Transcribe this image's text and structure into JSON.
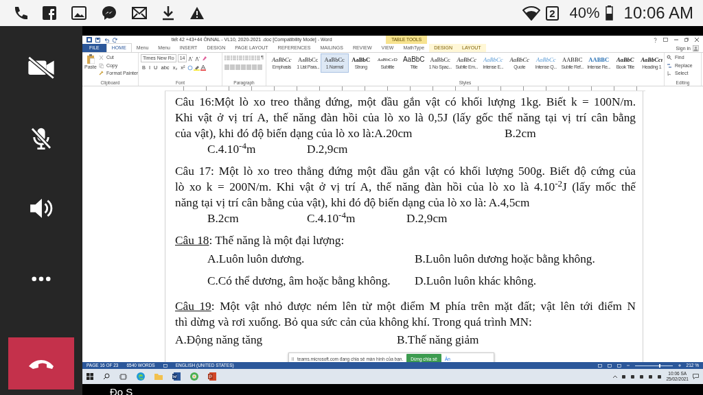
{
  "status_bar": {
    "sim": "2",
    "battery": "40%",
    "time": "10:06 AM"
  },
  "call_controls": {
    "camera_on": false,
    "mic_on": false
  },
  "participant": "Đo S",
  "word": {
    "title": "tiết 42 +43+44 ÔNNAL - VL10, 2020-2021 .doc [Compatibility Mode] - Word",
    "contextual_label": "TABLE TOOLS",
    "sign_in": "Sign in",
    "tabs": [
      {
        "label": "FILE",
        "kind": "file",
        "selected": false
      },
      {
        "label": "HOME",
        "kind": "normal",
        "selected": true
      },
      {
        "label": "Menu",
        "kind": "normal",
        "selected": false
      },
      {
        "label": "Menu",
        "kind": "normal",
        "selected": false
      },
      {
        "label": "INSERT",
        "kind": "normal",
        "selected": false
      },
      {
        "label": "DESIGN",
        "kind": "normal",
        "selected": false
      },
      {
        "label": "PAGE LAYOUT",
        "kind": "normal",
        "selected": false
      },
      {
        "label": "REFERENCES",
        "kind": "normal",
        "selected": false
      },
      {
        "label": "MAILINGS",
        "kind": "normal",
        "selected": false
      },
      {
        "label": "REVIEW",
        "kind": "normal",
        "selected": false
      },
      {
        "label": "VIEW",
        "kind": "normal",
        "selected": false
      },
      {
        "label": "MathType",
        "kind": "normal",
        "selected": false
      },
      {
        "label": "DESIGN",
        "kind": "contextual",
        "selected": false
      },
      {
        "label": "LAYOUT",
        "kind": "contextual",
        "selected": false
      }
    ],
    "clipboard": {
      "paste": "Paste",
      "cut": "Cut",
      "copy": "Copy",
      "format_painter": "Format Painter",
      "label": "Clipboard"
    },
    "font": {
      "name": "Times New Ro",
      "size": "14",
      "format_buttons": [
        "B",
        "I",
        "U",
        "abc",
        "x₂",
        "x²"
      ],
      "label": "Font"
    },
    "paragraph": {
      "marks": "¶",
      "label": "Paragraph"
    },
    "styles": {
      "label": "Styles",
      "items": [
        {
          "preview": "AaBbCc",
          "name": "Emphasis",
          "kind": "italic",
          "selected": false
        },
        {
          "preview": "AaBbCc",
          "name": "1 List Para...",
          "kind": "plain",
          "selected": false
        },
        {
          "preview": "AaBbCc",
          "name": "1 Normal",
          "kind": "plain",
          "selected": true
        },
        {
          "preview": "AaBbC",
          "name": "Strong",
          "kind": "bold",
          "selected": false
        },
        {
          "preview": "AaBbCcD",
          "name": "Subtitle",
          "kind": "small",
          "selected": false
        },
        {
          "preview": "AaBbC",
          "name": "Title",
          "kind": "title",
          "selected": false
        },
        {
          "preview": "AaBbCc",
          "name": "1 No Spac...",
          "kind": "plain",
          "selected": false
        },
        {
          "preview": "AaBbCc",
          "name": "Subtle Em...",
          "kind": "italic",
          "selected": false
        },
        {
          "preview": "AaBbCc",
          "name": "Intense E...",
          "kind": "accent",
          "selected": false
        },
        {
          "preview": "AaBbCc",
          "name": "Quote",
          "kind": "italic",
          "selected": false
        },
        {
          "preview": "AaBbCc",
          "name": "Intense Q...",
          "kind": "accent",
          "selected": false
        },
        {
          "preview": "AABBC",
          "name": "Subtle Ref...",
          "kind": "plain",
          "selected": false
        },
        {
          "preview": "AABBC",
          "name": "Intense Re...",
          "kind": "accentbold",
          "selected": false
        },
        {
          "preview": "AaBbC",
          "name": "Book Title",
          "kind": "bolditalic",
          "selected": false
        },
        {
          "preview": "AaBbCcı",
          "name": "Heading 1",
          "kind": "bolditalic",
          "selected": false
        }
      ]
    },
    "editing": {
      "label": "Editing",
      "items": [
        "Find",
        "Replace",
        "Select"
      ]
    },
    "document": [
      {
        "lines": [
          "Câu 16:Một lò xo treo thẳng đứng, một đầu gắn vật có khối lượng 1kg. Biết k  = 100N/m.",
          "Khi vật ở vị trí A, thế năng đàn hồi của lò xo là 0,5J (lấy gốc thế năng tại vị trí cân bằng"
        ],
        "tail": {
          "text": "của vật), khi đó độ biến dạng của lò xo là:A.20cm",
          "option": "B.2cm"
        },
        "rows": [
          {
            "kind": "quarter",
            "cells": [
              "C.4.10$^{-4}$m",
              "D.2,9cm"
            ]
          }
        ]
      },
      {
        "lines": [
          "Câu 17: Một lò xo treo thẳng đứng một đầu gắn vật có khối lượng 500g. Biết độ cứng của",
          "lò xo k = 200N/m. Khi vật ở vị trí A, thế năng đàn hồi của lò xo là 4.10$^{-2}$J (lấy mốc thế",
          "năng tại vị trí cân bằng của vật), khi đó độ biến dạng của lò xo là:  A.4,5cm"
        ],
        "rows": [
          {
            "kind": "quarter",
            "cells": [
              "B.2cm",
              "C.4.10$^{-4}$m",
              "D.2,9cm"
            ]
          }
        ]
      },
      {
        "label": "Câu 18",
        "label_underlined": true,
        "lines": [
          ": Thế năng là một đại lượng:"
        ],
        "rows": [
          {
            "kind": "half",
            "cells": [
              "A.Luôn luôn dương.",
              "B.Luôn luôn dương hoặc bằng không."
            ]
          },
          {
            "kind": "half",
            "cells": [
              "C.Có thể dương, âm hoặc bằng không.",
              "D.Luôn luôn khác không."
            ]
          }
        ]
      },
      {
        "label": "Câu 19",
        "label_underlined": true,
        "lines": [
          ": Một vật nhỏ được ném lên từ một điểm M phía trên mặt đất; vật lên tới điểm N",
          "thì dừng và rơi xuống. Bỏ qua sức cản của không khí. Trong quá trình MN:"
        ],
        "rows": [
          {
            "kind": "split",
            "cells": [
              "A.Động năng tăng",
              "B.Thế năng giảm"
            ]
          }
        ]
      }
    ],
    "share_notice": {
      "message": "teams.microsoft.com đang chia sẻ màn hình của bạn.",
      "stop": "Dừng chia sẻ",
      "hide": "Ẩn"
    },
    "status": {
      "page": "PAGE 16 OF 23",
      "words": "6540 WORDS",
      "language": "ENGLISH (UNITED STATES)",
      "zoom": "212 %",
      "level": 0.67
    }
  },
  "taskbar": {
    "time": "10:06 SA",
    "date": "25/02/2021"
  }
}
